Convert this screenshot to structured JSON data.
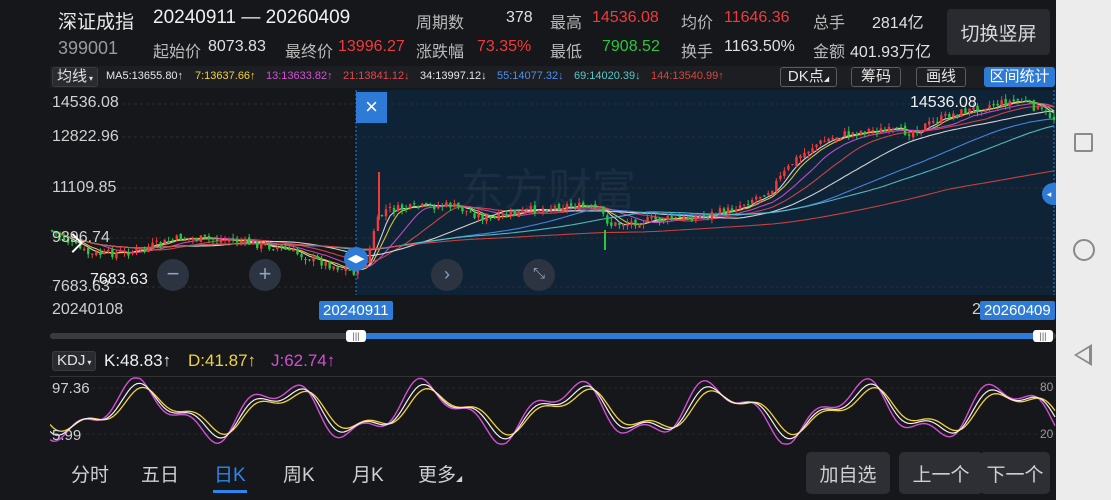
{
  "header": {
    "name": "深证成指",
    "code": "399001",
    "range": "20240911 — 20260409",
    "stats": [
      {
        "label": "周期数",
        "value": "378",
        "color": "normal"
      },
      {
        "label": "最高",
        "value": "14536.08",
        "color": "red"
      },
      {
        "label": "均价",
        "value": "11646.36",
        "color": "red"
      },
      {
        "label": "总手",
        "value": "2814亿",
        "color": "normal"
      },
      {
        "label": "起始价",
        "value": "8073.83",
        "color": "normal"
      },
      {
        "label": "最终价",
        "value": "13996.27",
        "color": "red"
      },
      {
        "label": "涨跌幅",
        "value": "73.35%",
        "color": "red"
      },
      {
        "label": "最低",
        "value": "7908.52",
        "color": "green"
      },
      {
        "label": "换手",
        "value": "1163.50%",
        "color": "normal"
      },
      {
        "label": "金额",
        "value": "401.93万亿",
        "color": "normal"
      }
    ],
    "switch_button": "切换竖屏"
  },
  "ma_bar": {
    "selector": "均线",
    "items": [
      {
        "text": "MA5:13655.80↑",
        "color": "#e6e6e6"
      },
      {
        "text": "7:13637.66↑",
        "color": "#f2d23c"
      },
      {
        "text": "13:13633.82↑",
        "color": "#d34fd3"
      },
      {
        "text": "21:13841.12↓",
        "color": "#e0474c"
      },
      {
        "text": "34:13997.12↓",
        "color": "#e6e6e6"
      },
      {
        "text": "55:14077.32↓",
        "color": "#4a8ff0"
      },
      {
        "text": "69:14020.39↓",
        "color": "#58c7c9"
      },
      {
        "text": "144:13540.99↑",
        "color": "#d8463b"
      }
    ],
    "buttons": [
      "DK点",
      "筹码",
      "画线",
      "区间统计"
    ]
  },
  "main_chart": {
    "y_labels": [
      "14536.08",
      "12822.96",
      "11109.85",
      "9396.74",
      "7683.63"
    ],
    "high_marker": "14536.08",
    "low_marker": "7683.63",
    "start_date": "20240108",
    "range_start": "20240911",
    "range_end": "20260409",
    "close_icon": "×",
    "watermark": "东方财富"
  },
  "kdj": {
    "selector": "KDJ",
    "k": "K:48.83",
    "d": "D:41.87",
    "j": "J:62.74",
    "top_label": "97.36",
    "bottom_label": "5.99",
    "right_top": "80",
    "right_bottom": "20"
  },
  "tabs": {
    "items": [
      "分时",
      "五日",
      "日K",
      "周K",
      "月K",
      "更多"
    ],
    "active": "日K",
    "buttons": [
      "加自选",
      "上一个",
      "下一个"
    ]
  },
  "colors": {
    "background": "#16171b",
    "up": "#f03b3b",
    "down": "#2cc63c",
    "accent": "#2d7bd6"
  }
}
